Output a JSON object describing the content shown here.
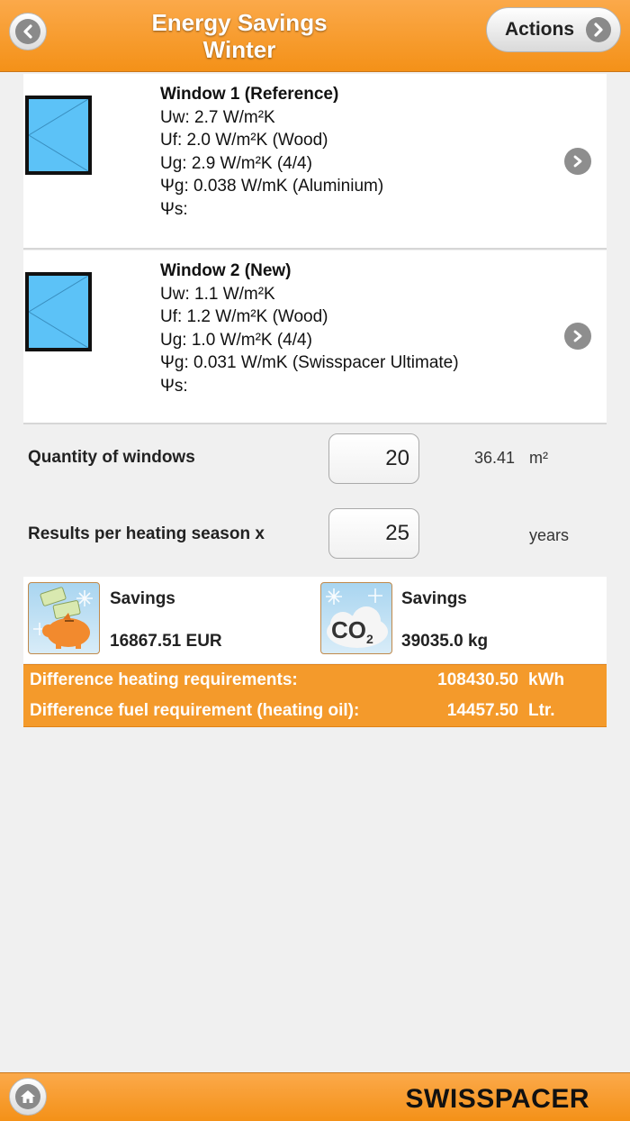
{
  "header": {
    "title_line1": "Energy Savings",
    "title_line2": "Winter",
    "back_icon": "chevron-left-icon",
    "actions_label": "Actions",
    "actions_icon": "chevron-right-icon"
  },
  "windows": [
    {
      "title": "Window 1 (Reference)",
      "uw": "Uw: 2.7 W/m²K",
      "uf": "Uf: 2.0 W/m²K (Wood)",
      "ug": "Ug: 2.9 W/m²K (4/4)",
      "psig": "Ψg: 0.038 W/mK (Aluminium)",
      "psis": "Ψs:"
    },
    {
      "title": "Window 2 (New)",
      "uw": "Uw: 1.1 W/m²K",
      "uf": "Uf: 1.2 W/m²K (Wood)",
      "ug": "Ug: 1.0 W/m²K (4/4)",
      "psig": "Ψg: 0.031 W/mK (Swisspacer Ultimate)",
      "psis": "Ψs:"
    }
  ],
  "quantity": {
    "label": "Quantity of windows",
    "value": "20",
    "area": "36.41",
    "area_unit": "m²"
  },
  "season": {
    "label": "Results per heating season x",
    "value": "25",
    "unit": "years"
  },
  "savings": {
    "money": {
      "title": "Savings",
      "value": "16867.51 EUR",
      "icon": "piggy-bank-icon"
    },
    "co2": {
      "title": "Savings",
      "value": "39035.0 kg",
      "icon": "co2-cloud-icon",
      "icon_text": "CO",
      "icon_sub": "2"
    }
  },
  "differences": [
    {
      "label": "Difference heating requirements:",
      "value": "108430.50",
      "unit": "kWh"
    },
    {
      "label": "Difference fuel requirement (heating oil):",
      "value": "14457.50",
      "unit": "Ltr."
    }
  ],
  "footer": {
    "home_icon": "home-icon",
    "brand": "SWISSPACER"
  },
  "colors": {
    "accent": "#f49a2b",
    "window_glass": "#5cc2f7"
  }
}
